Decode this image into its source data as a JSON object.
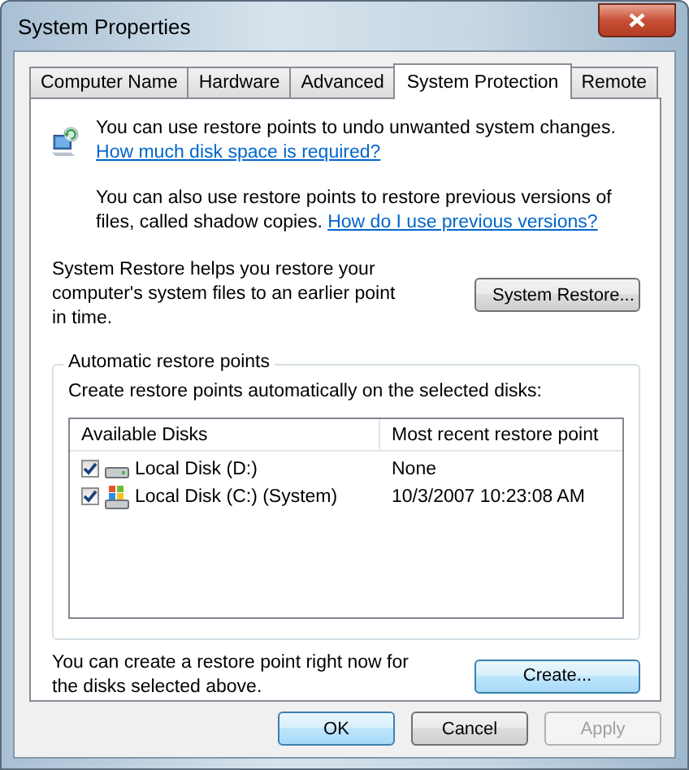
{
  "window": {
    "title": "System Properties"
  },
  "tabs": [
    {
      "label": "Computer Name",
      "selected": false
    },
    {
      "label": "Hardware",
      "selected": false
    },
    {
      "label": "Advanced",
      "selected": false
    },
    {
      "label": "System Protection",
      "selected": true
    },
    {
      "label": "Remote",
      "selected": false
    }
  ],
  "intro": {
    "text": "You can use restore points to undo unwanted system changes.",
    "link": "How much disk space is required?"
  },
  "shadow_copies": {
    "text": "You can also use restore points to restore previous versions of files, called shadow copies.",
    "link": "How do I use previous versions?"
  },
  "system_restore": {
    "text": "System Restore helps you restore your computer's system files to an earlier point in time.",
    "button": {
      "label": "System Restore...",
      "highlighted": false,
      "disabled": false
    }
  },
  "automatic": {
    "title": "Automatic restore points",
    "description": "Create restore points automatically on the selected disks:",
    "columns": [
      "Available Disks",
      "Most recent restore point"
    ],
    "rows": [
      {
        "kind": "drive",
        "checked": true,
        "name": "Local Disk (D:)",
        "restore_point": "None"
      },
      {
        "kind": "system-drive",
        "checked": true,
        "name": "Local Disk (C:) (System)",
        "restore_point": "10/3/2007 10:23:08 AM"
      }
    ]
  },
  "create": {
    "text": "You can create a restore point right now for the disks selected above.",
    "button": {
      "label": "Create...",
      "highlighted": true,
      "disabled": false
    }
  },
  "buttons": [
    {
      "label": "OK",
      "highlighted": true,
      "disabled": false
    },
    {
      "label": "Cancel",
      "highlighted": false,
      "disabled": false
    },
    {
      "label": "Apply",
      "highlighted": false,
      "disabled": true
    }
  ]
}
